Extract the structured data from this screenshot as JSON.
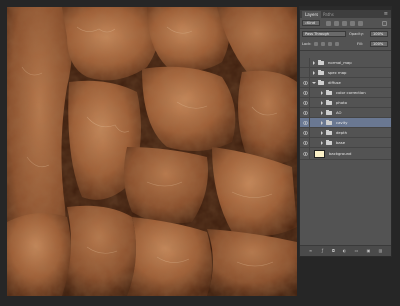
{
  "canvas": {
    "description_icon": "rock-texture-canvas"
  },
  "panel": {
    "tabs": [
      {
        "label": "Layers",
        "active": true
      },
      {
        "label": "Paths",
        "active": false
      }
    ],
    "filter": {
      "kind_label": "Kind"
    },
    "blend": {
      "mode": "Pass Through",
      "opacity_label": "Opacity:",
      "opacity_value": "100%"
    },
    "lock": {
      "label": "Lock:",
      "fill_label": "Fill:",
      "fill_value": "100%"
    },
    "layers": [
      {
        "name": "normal_map",
        "type": "folder",
        "expanded": false,
        "indent": 0,
        "visible": false
      },
      {
        "name": "spec map",
        "type": "folder",
        "expanded": false,
        "indent": 0,
        "visible": false
      },
      {
        "name": "diffuse",
        "type": "folder",
        "expanded": true,
        "indent": 0,
        "visible": true
      },
      {
        "name": "color correction",
        "type": "folder",
        "expanded": false,
        "indent": 1,
        "visible": true
      },
      {
        "name": "photo",
        "type": "folder",
        "expanded": false,
        "indent": 1,
        "visible": true
      },
      {
        "name": "AO",
        "type": "folder",
        "expanded": false,
        "indent": 1,
        "visible": true
      },
      {
        "name": "cavity",
        "type": "folder",
        "expanded": false,
        "indent": 1,
        "visible": true,
        "selected": true
      },
      {
        "name": "depth",
        "type": "folder",
        "expanded": false,
        "indent": 1,
        "visible": true
      },
      {
        "name": "base",
        "type": "folder",
        "expanded": false,
        "indent": 1,
        "visible": true
      },
      {
        "name": "background",
        "type": "pixel",
        "indent": 0,
        "visible": true,
        "thumb_color": "#fbf1c8"
      }
    ],
    "accent_selected": "#6a7892"
  }
}
